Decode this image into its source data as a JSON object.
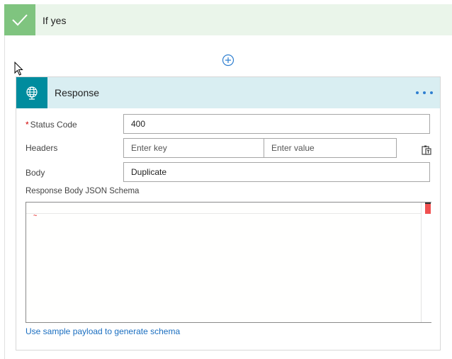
{
  "condition": {
    "label": "If yes",
    "accent_color": "#7fc47f",
    "header_color": "#eaf5ea"
  },
  "add_step": {
    "icon": "plus-circle-icon"
  },
  "action": {
    "title": "Response",
    "icon": "globe-icon",
    "icon_bg": "#008c9e",
    "header_bg": "#d9eef2",
    "more_icon": "ellipsis-icon"
  },
  "fields": {
    "status_code": {
      "label": "Status Code",
      "required_mark": "*",
      "value": "400"
    },
    "headers": {
      "label": "Headers",
      "key_placeholder": "Enter key",
      "value_placeholder": "Enter value"
    },
    "body": {
      "label": "Body",
      "value": "Duplicate"
    },
    "schema": {
      "label": "Response Body JSON Schema"
    }
  },
  "schema_link": "Use sample payload to generate schema"
}
